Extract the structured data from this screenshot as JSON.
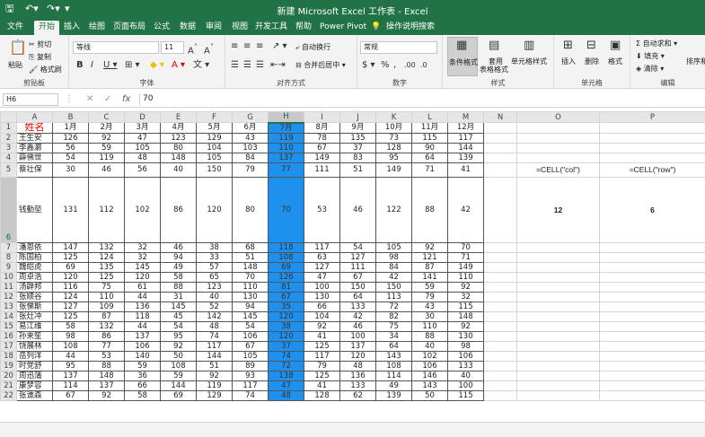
{
  "title": "新建 Microsoft Excel 工作表 - Excel",
  "tabs": [
    "文件",
    "开始",
    "插入",
    "绘图",
    "页面布局",
    "公式",
    "数据",
    "审阅",
    "视图",
    "开发工具",
    "帮助",
    "Power Pivot",
    "操作说明搜索"
  ],
  "ribbon": {
    "paste": "粘贴",
    "cut": "剪切",
    "copy": "复制",
    "format_painter": "格式刷",
    "clipboard": "剪贴板",
    "font_name": "等线",
    "font_size": "11",
    "font_group": "字体",
    "wrap": "自动换行",
    "merge": "合并后居中",
    "align_group": "对齐方式",
    "num_format": "常规",
    "number_group": "数字",
    "cond_format": "条件格式",
    "table_format_1": "套用",
    "table_format_2": "表格格式",
    "cell_style": "单元格样式",
    "styles_group": "样式",
    "insert": "插入",
    "delete": "删除",
    "format": "格式",
    "cells_group": "单元格",
    "autosum": "自动求和",
    "fill": "填充",
    "clear": "清除",
    "sort": "排序和",
    "edit_group": "编辑"
  },
  "namebox": "H6",
  "formula_value": "70",
  "columns": [
    "A",
    "B",
    "C",
    "D",
    "E",
    "F",
    "G",
    "H",
    "I",
    "J",
    "K",
    "L",
    "M",
    "N",
    "O",
    "P"
  ],
  "header_row": [
    "姓名",
    "1月",
    "2月",
    "3月",
    "4月",
    "5月",
    "6月",
    "7月",
    "8月",
    "9月",
    "10月",
    "11月",
    "12月"
  ],
  "rows": [
    {
      "n": "2",
      "c": [
        "王生安",
        "126",
        "92",
        "47",
        "123",
        "129",
        "43",
        "119",
        "78",
        "135",
        "73",
        "115",
        "117"
      ]
    },
    {
      "n": "3",
      "c": [
        "李鑫灏",
        "56",
        "59",
        "105",
        "80",
        "104",
        "103",
        "110",
        "67",
        "37",
        "128",
        "90",
        "144"
      ]
    },
    {
      "n": "4",
      "c": [
        "薛佛世",
        "54",
        "119",
        "48",
        "148",
        "105",
        "84",
        "137",
        "149",
        "83",
        "95",
        "64",
        "139"
      ]
    },
    {
      "n": "5",
      "c": [
        "蔡壮保",
        "30",
        "46",
        "56",
        "40",
        "150",
        "79",
        "77",
        "111",
        "51",
        "149",
        "71",
        "41"
      ]
    },
    {
      "n": "6",
      "c": [
        "钱勤堃",
        "131",
        "112",
        "102",
        "86",
        "120",
        "80",
        "70",
        "53",
        "46",
        "122",
        "88",
        "42"
      ]
    },
    {
      "n": "7",
      "c": [
        "潘恩依",
        "147",
        "132",
        "32",
        "46",
        "38",
        "68",
        "118",
        "117",
        "54",
        "105",
        "92",
        "70"
      ]
    },
    {
      "n": "8",
      "c": [
        "陈国柏",
        "125",
        "124",
        "32",
        "94",
        "33",
        "51",
        "108",
        "63",
        "127",
        "98",
        "121",
        "71"
      ]
    },
    {
      "n": "9",
      "c": [
        "魏皑虎",
        "69",
        "135",
        "145",
        "49",
        "57",
        "148",
        "69",
        "127",
        "111",
        "84",
        "87",
        "149"
      ]
    },
    {
      "n": "10",
      "c": [
        "周卓浩",
        "120",
        "125",
        "120",
        "58",
        "65",
        "70",
        "126",
        "47",
        "67",
        "42",
        "141",
        "110"
      ]
    },
    {
      "n": "11",
      "c": [
        "汤辟邦",
        "116",
        "75",
        "61",
        "88",
        "123",
        "110",
        "81",
        "100",
        "150",
        "150",
        "59",
        "92"
      ]
    },
    {
      "n": "12",
      "c": [
        "张顺谷",
        "124",
        "110",
        "44",
        "31",
        "40",
        "130",
        "67",
        "130",
        "64",
        "113",
        "79",
        "32"
      ]
    },
    {
      "n": "13",
      "c": [
        "张悌斯",
        "127",
        "109",
        "136",
        "145",
        "52",
        "94",
        "35",
        "66",
        "133",
        "72",
        "43",
        "115"
      ]
    },
    {
      "n": "14",
      "c": [
        "张灶冲",
        "125",
        "87",
        "118",
        "45",
        "142",
        "145",
        "120",
        "104",
        "42",
        "82",
        "30",
        "148"
      ]
    },
    {
      "n": "15",
      "c": [
        "易江维",
        "58",
        "132",
        "44",
        "54",
        "48",
        "54",
        "38",
        "92",
        "46",
        "75",
        "110",
        "92"
      ]
    },
    {
      "n": "16",
      "c": [
        "孙来笙",
        "98",
        "86",
        "137",
        "95",
        "74",
        "106",
        "120",
        "41",
        "100",
        "34",
        "88",
        "130"
      ]
    },
    {
      "n": "17",
      "c": [
        "饶展林",
        "108",
        "77",
        "106",
        "92",
        "117",
        "67",
        "37",
        "125",
        "137",
        "64",
        "40",
        "98"
      ]
    },
    {
      "n": "18",
      "c": [
        "岳列洋",
        "44",
        "53",
        "140",
        "50",
        "144",
        "105",
        "74",
        "117",
        "120",
        "143",
        "102",
        "106"
      ]
    },
    {
      "n": "19",
      "c": [
        "时党舒",
        "95",
        "88",
        "59",
        "108",
        "51",
        "89",
        "72",
        "79",
        "48",
        "108",
        "106",
        "133"
      ]
    },
    {
      "n": "20",
      "c": [
        "周迅蒲",
        "137",
        "148",
        "36",
        "59",
        "92",
        "93",
        "138",
        "125",
        "136",
        "114",
        "146",
        "40"
      ]
    },
    {
      "n": "21",
      "c": [
        "康梦容",
        "114",
        "137",
        "66",
        "144",
        "119",
        "117",
        "47",
        "41",
        "133",
        "49",
        "143",
        "100"
      ]
    },
    {
      "n": "22",
      "c": [
        "张谯森",
        "67",
        "92",
        "58",
        "69",
        "129",
        "74",
        "48",
        "128",
        "62",
        "139",
        "50",
        "115"
      ]
    }
  ],
  "formula_col": "=CELL(\"col\")",
  "formula_row": "=CELL(\"row\")",
  "result_col": "12",
  "result_row": "6",
  "accent": "#217346",
  "selection_color": "#1e90ee"
}
